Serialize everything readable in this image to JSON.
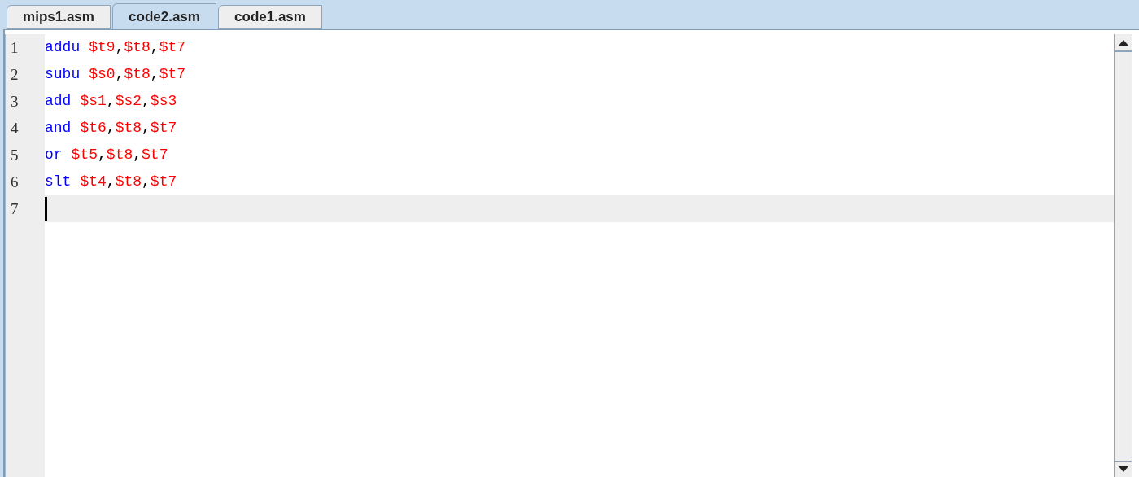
{
  "tabs": [
    {
      "label": "mips1.asm",
      "selected": false
    },
    {
      "label": "code2.asm",
      "selected": true
    },
    {
      "label": "code1.asm",
      "selected": false
    }
  ],
  "editor": {
    "lines": [
      {
        "number": "1",
        "current": false,
        "tokens": [
          {
            "kind": "keyword",
            "text": "addu"
          },
          {
            "kind": "register",
            "text": "$t9"
          },
          {
            "kind": "punct",
            "text": ","
          },
          {
            "kind": "register",
            "text": "$t8"
          },
          {
            "kind": "punct",
            "text": ","
          },
          {
            "kind": "register",
            "text": "$t7"
          }
        ]
      },
      {
        "number": "2",
        "current": false,
        "tokens": [
          {
            "kind": "keyword",
            "text": "subu"
          },
          {
            "kind": "register",
            "text": "$s0"
          },
          {
            "kind": "punct",
            "text": ","
          },
          {
            "kind": "register",
            "text": "$t8"
          },
          {
            "kind": "punct",
            "text": ","
          },
          {
            "kind": "register",
            "text": "$t7"
          }
        ]
      },
      {
        "number": "3",
        "current": false,
        "tokens": [
          {
            "kind": "keyword",
            "text": "add"
          },
          {
            "kind": "register",
            "text": "$s1"
          },
          {
            "kind": "punct",
            "text": ","
          },
          {
            "kind": "register",
            "text": "$s2"
          },
          {
            "kind": "punct",
            "text": ","
          },
          {
            "kind": "register",
            "text": "$s3"
          }
        ]
      },
      {
        "number": "4",
        "current": false,
        "tokens": [
          {
            "kind": "keyword",
            "text": "and"
          },
          {
            "kind": "register",
            "text": "$t6"
          },
          {
            "kind": "punct",
            "text": ","
          },
          {
            "kind": "register",
            "text": "$t8"
          },
          {
            "kind": "punct",
            "text": ","
          },
          {
            "kind": "register",
            "text": "$t7"
          }
        ]
      },
      {
        "number": "5",
        "current": false,
        "tokens": [
          {
            "kind": "keyword",
            "text": "or"
          },
          {
            "kind": "register",
            "text": "$t5"
          },
          {
            "kind": "punct",
            "text": ","
          },
          {
            "kind": "register",
            "text": "$t8"
          },
          {
            "kind": "punct",
            "text": ","
          },
          {
            "kind": "register",
            "text": "$t7"
          }
        ]
      },
      {
        "number": "6",
        "current": false,
        "tokens": [
          {
            "kind": "keyword",
            "text": "slt"
          },
          {
            "kind": "register",
            "text": "$t4"
          },
          {
            "kind": "punct",
            "text": ","
          },
          {
            "kind": "register",
            "text": "$t8"
          },
          {
            "kind": "punct",
            "text": ","
          },
          {
            "kind": "register",
            "text": "$t7"
          }
        ]
      },
      {
        "number": "7",
        "current": true
      }
    ]
  }
}
